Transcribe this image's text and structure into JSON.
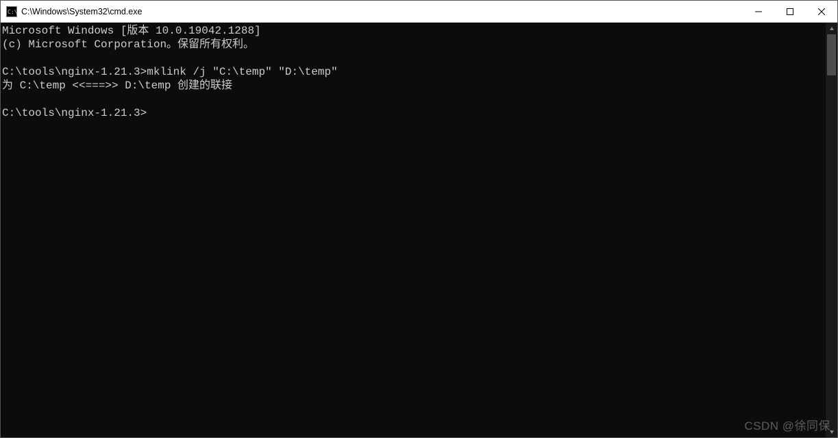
{
  "titlebar": {
    "title": "C:\\Windows\\System32\\cmd.exe"
  },
  "console": {
    "lines": [
      "Microsoft Windows [版本 10.0.19042.1288]",
      "(c) Microsoft Corporation。保留所有权利。",
      "",
      "C:\\tools\\nginx-1.21.3>mklink /j \"C:\\temp\" \"D:\\temp\"",
      "为 C:\\temp <<===>> D:\\temp 创建的联接",
      "",
      "C:\\tools\\nginx-1.21.3>"
    ]
  },
  "watermark": "CSDN @徐同保"
}
